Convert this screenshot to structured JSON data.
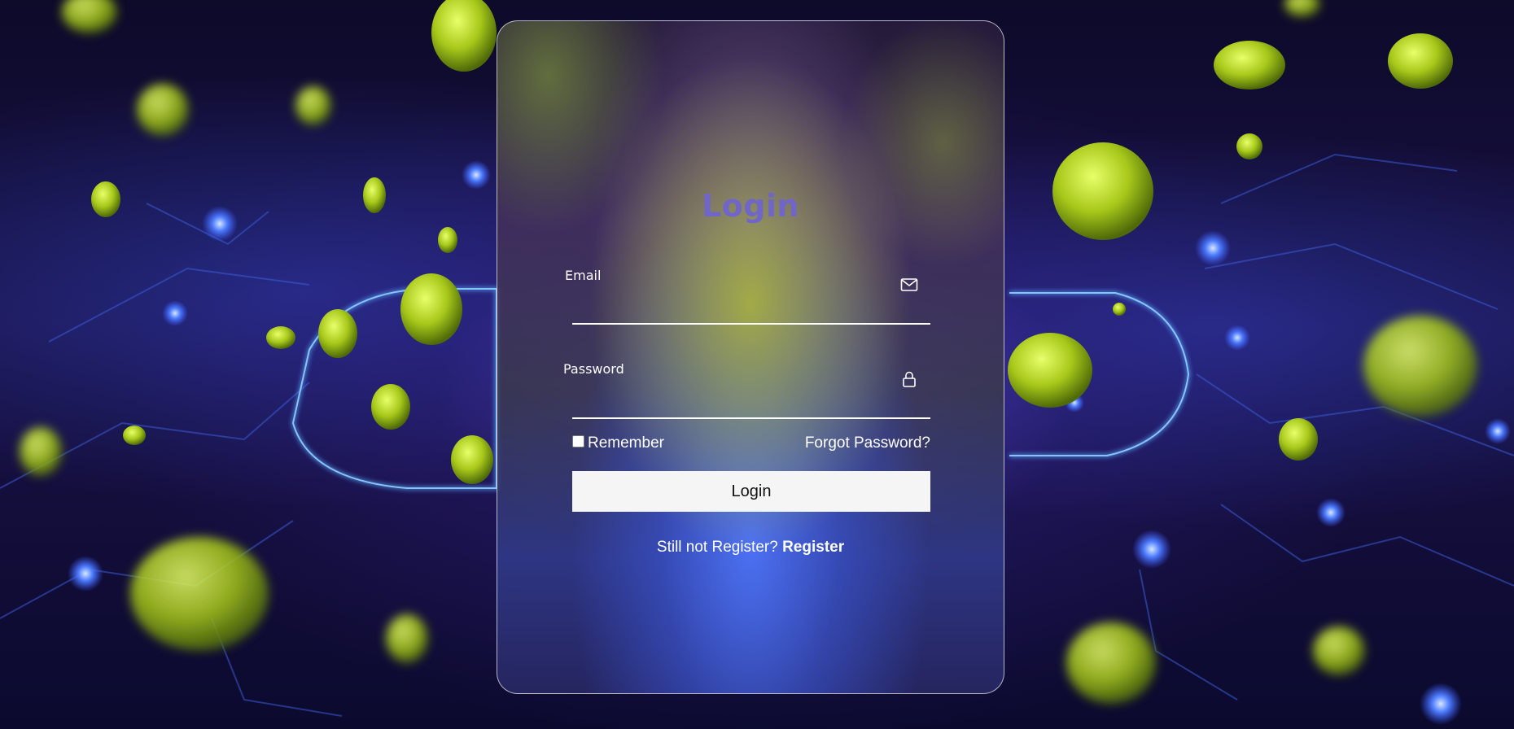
{
  "login_card": {
    "title": "Login",
    "email": {
      "label": "Email",
      "value": "",
      "icon": "envelope-icon"
    },
    "password": {
      "label": "Password",
      "value": "",
      "icon": "lock-icon"
    },
    "remember": {
      "label": "Remember",
      "checked": false
    },
    "forgot_password_label": "Forgot Password?",
    "login_button_label": "Login",
    "register_prompt": "Still not Register?",
    "register_link_label": "Register"
  },
  "colors": {
    "title": "#6f66c8",
    "text": "#ffffff",
    "button_bg": "#f5f5f5",
    "button_text": "#111111",
    "card_border": "#ffffff"
  }
}
